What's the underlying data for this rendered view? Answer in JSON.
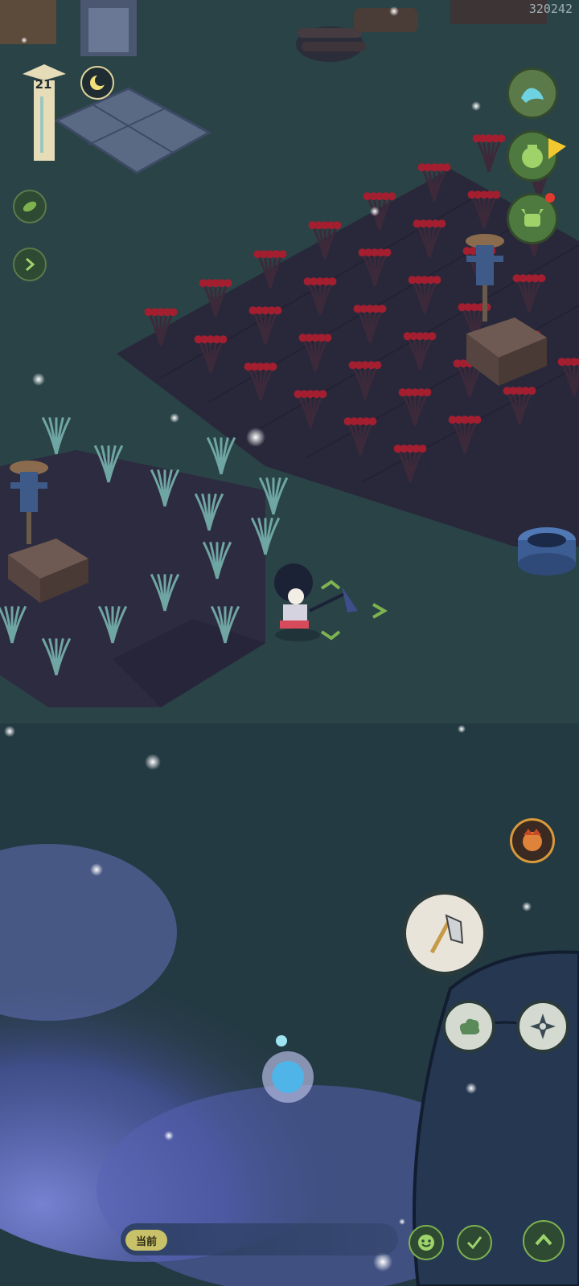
{
  "hud": {
    "session_id": "320242",
    "level": "21",
    "chat_channel": "当前"
  },
  "icons": {
    "top_right": [
      "wave-icon",
      "pot-icon",
      "ox-icon"
    ],
    "left": [
      "leaf-icon",
      "arrow-right-icon"
    ],
    "actions": [
      "hoe-icon",
      "cloud-icon",
      "shuriken-icon"
    ],
    "bottom": [
      "smile-icon",
      "check-icon",
      "chevron-up-icon"
    ],
    "special": "fire-mask-icon"
  },
  "colors": {
    "night_ground": "#2a4347",
    "soil": "#2a2a3e",
    "crop_red": "#8d1b2a",
    "crop_green": "#6fa6a3",
    "hud_green": "#7eb24f",
    "notification_red": "#e23a2e"
  }
}
